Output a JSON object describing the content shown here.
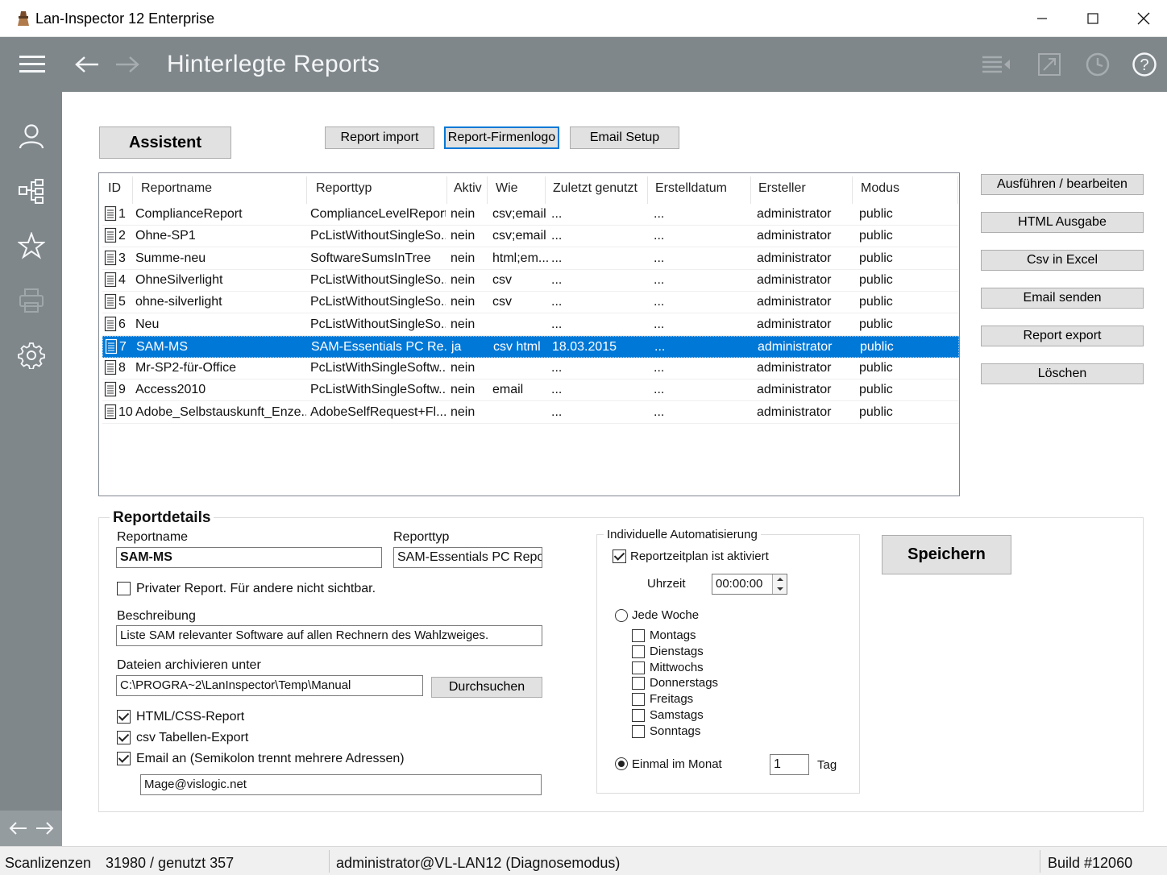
{
  "window": {
    "title": "Lan-Inspector 12 Enterprise",
    "controls": [
      "minimize-icon",
      "maximize-icon",
      "close-icon"
    ]
  },
  "header": {
    "title": "Hinterlegte Reports",
    "left_icons": [
      "hamburger-menu-icon",
      "arrow-left-icon",
      "arrow-right-icon"
    ],
    "right_icons": [
      "list-collapse-icon",
      "expand-icon",
      "clock-icon",
      "help-icon"
    ]
  },
  "sidebar": {
    "items": [
      "user-icon",
      "network-tree-icon",
      "star-icon",
      "printer-icon",
      "gear-icon"
    ],
    "bottom_nav": [
      "arrow-left-icon",
      "arrow-right-icon"
    ]
  },
  "toolbar": {
    "assistant": "Assistent",
    "report_import": "Report import",
    "report_logo": "Report-Firmenlogo",
    "email_setup": "Email Setup"
  },
  "actions": {
    "run_edit": "Ausführen / bearbeiten",
    "html_output": "HTML Ausgabe",
    "csv_excel": "Csv in Excel",
    "send_email": "Email senden",
    "report_export": "Report export",
    "delete": "Löschen"
  },
  "table": {
    "columns": [
      "ID",
      "Reportname",
      "Reporttyp",
      "Aktiv",
      "Wie",
      "Zuletzt genutzt",
      "Erstelldatum",
      "Ersteller",
      "Modus"
    ],
    "rows": [
      {
        "id": "1",
        "name": "ComplianceReport",
        "type": "ComplianceLevelReport",
        "active": "nein",
        "how": "csv;email",
        "last_used": "...",
        "created": "...",
        "creator": "administrator",
        "mode": "public"
      },
      {
        "id": "2",
        "name": "Ohne-SP1",
        "type": "PcListWithoutSingleSo...",
        "active": "nein",
        "how": "csv;email",
        "last_used": "...",
        "created": "...",
        "creator": "administrator",
        "mode": "public"
      },
      {
        "id": "3",
        "name": "Summe-neu",
        "type": "SoftwareSumsInTree",
        "active": "nein",
        "how": "html;em...",
        "last_used": "...",
        "created": "...",
        "creator": "administrator",
        "mode": "public"
      },
      {
        "id": "4",
        "name": "OhneSilverlight",
        "type": "PcListWithoutSingleSo...",
        "active": "nein",
        "how": "csv",
        "last_used": "...",
        "created": "...",
        "creator": "administrator",
        "mode": "public"
      },
      {
        "id": "5",
        "name": "ohne-silverlight",
        "type": "PcListWithoutSingleSo...",
        "active": "nein",
        "how": "csv",
        "last_used": "...",
        "created": "...",
        "creator": "administrator",
        "mode": "public"
      },
      {
        "id": "6",
        "name": "Neu",
        "type": "PcListWithoutSingleSo...",
        "active": "nein",
        "how": "",
        "last_used": "...",
        "created": "...",
        "creator": "administrator",
        "mode": "public"
      },
      {
        "id": "7",
        "name": "SAM-MS",
        "type": "SAM-Essentials PC Re...",
        "active": "ja",
        "how": "csv html",
        "last_used": "18.03.2015",
        "created": "...",
        "creator": "administrator",
        "mode": "public",
        "selected": true
      },
      {
        "id": "8",
        "name": "Mr-SP2-für-Office",
        "type": "PcListWithSingleSoftw...",
        "active": "nein",
        "how": "",
        "last_used": "...",
        "created": "...",
        "creator": "administrator",
        "mode": "public"
      },
      {
        "id": "9",
        "name": "Access2010",
        "type": "PcListWithSingleSoftw...",
        "active": "nein",
        "how": "email",
        "last_used": "...",
        "created": "...",
        "creator": "administrator",
        "mode": "public"
      },
      {
        "id": "10",
        "name": "Adobe_Selbstauskunft_Enze...",
        "type": "AdobeSelfRequest+Fl...",
        "active": "nein",
        "how": "",
        "last_used": "...",
        "created": "...",
        "creator": "administrator",
        "mode": "public"
      }
    ]
  },
  "details": {
    "section_title": "Reportdetails",
    "reportname_label": "Reportname",
    "reportname_value": "SAM-MS",
    "reporttype_label": "Reporttyp",
    "reporttype_value": "SAM-Essentials PC Report",
    "private_label": "Privater Report. Für andere nicht sichtbar.",
    "private_checked": false,
    "description_label": "Beschreibung",
    "description_value": "Liste SAM relevanter Software auf allen Rechnern des Wahlzweiges.",
    "archive_label": "Dateien archivieren unter",
    "archive_value": "C:\\PROGRA~2\\LanInspector\\Temp\\Manual",
    "browse": "Durchsuchen",
    "html_css_label": "HTML/CSS-Report",
    "html_css_checked": true,
    "csv_label": "csv Tabellen-Export",
    "csv_checked": true,
    "email_label": "Email an (Semikolon trennt mehrere Adressen)",
    "email_checked": true,
    "email_value": "Mage@vislogic.net",
    "save": "Speichern"
  },
  "automation": {
    "group_title": "Individuelle Automatisierung",
    "schedule_label": "Reportzeitplan ist aktiviert",
    "schedule_checked": true,
    "time_label": "Uhrzeit",
    "time_value": "00:00:00",
    "weekly_label": "Jede Woche",
    "weekly_selected": false,
    "days": [
      {
        "label": "Montags",
        "checked": false
      },
      {
        "label": "Dienstags",
        "checked": false
      },
      {
        "label": "Mittwochs",
        "checked": false
      },
      {
        "label": "Donnerstags",
        "checked": false
      },
      {
        "label": "Freitags",
        "checked": false
      },
      {
        "label": "Samstags",
        "checked": false
      },
      {
        "label": "Sonntags",
        "checked": false
      }
    ],
    "monthly_label": "Einmal im Monat",
    "monthly_selected": true,
    "day_value": "1",
    "day_unit": "Tag"
  },
  "statusbar": {
    "licenses_label": "Scanlizenzen",
    "licenses_value": "31980 / genutzt 357",
    "user": "administrator@VL-LAN12 (Diagnosemodus)",
    "build": "Build #12060"
  },
  "colors": {
    "header_bg": "#7f878b",
    "selection": "#0078d7",
    "button_bg": "#e1e1e1"
  }
}
